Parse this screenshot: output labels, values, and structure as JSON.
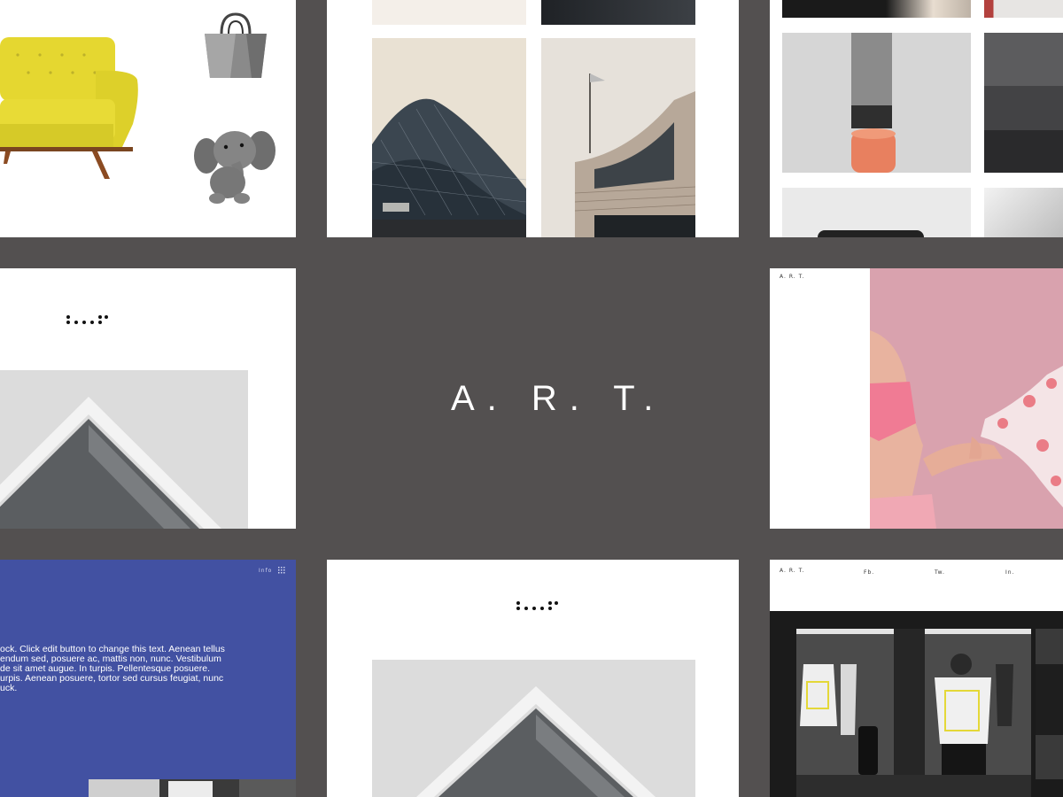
{
  "brand": {
    "logo_text": "A. R. T.",
    "small_logo": "A. R. T."
  },
  "tiles": {
    "ecommerce": {
      "items": [
        "armchair",
        "handbag",
        "plush-elephant"
      ]
    },
    "blue_panel": {
      "info_label": "Info",
      "text_lines": [
        "ock. Click edit button to change this text. Aenean tellus",
        "endum sed, posuere ac, mattis non, nunc. Vestibulum",
        "de sit amet augue. In turpis. Pellentesque posuere.",
        "urpis. Aenean posuere, tortor sed cursus feugiat, nunc",
        "uck."
      ]
    },
    "store_nav": {
      "logo": "A. R. T.",
      "links": [
        "Fb.",
        "Tw.",
        "In."
      ]
    }
  },
  "colors": {
    "background": "#535050",
    "blue": "#4251a2",
    "pink": "#d9a2ae",
    "yellow": "#e4d838"
  }
}
